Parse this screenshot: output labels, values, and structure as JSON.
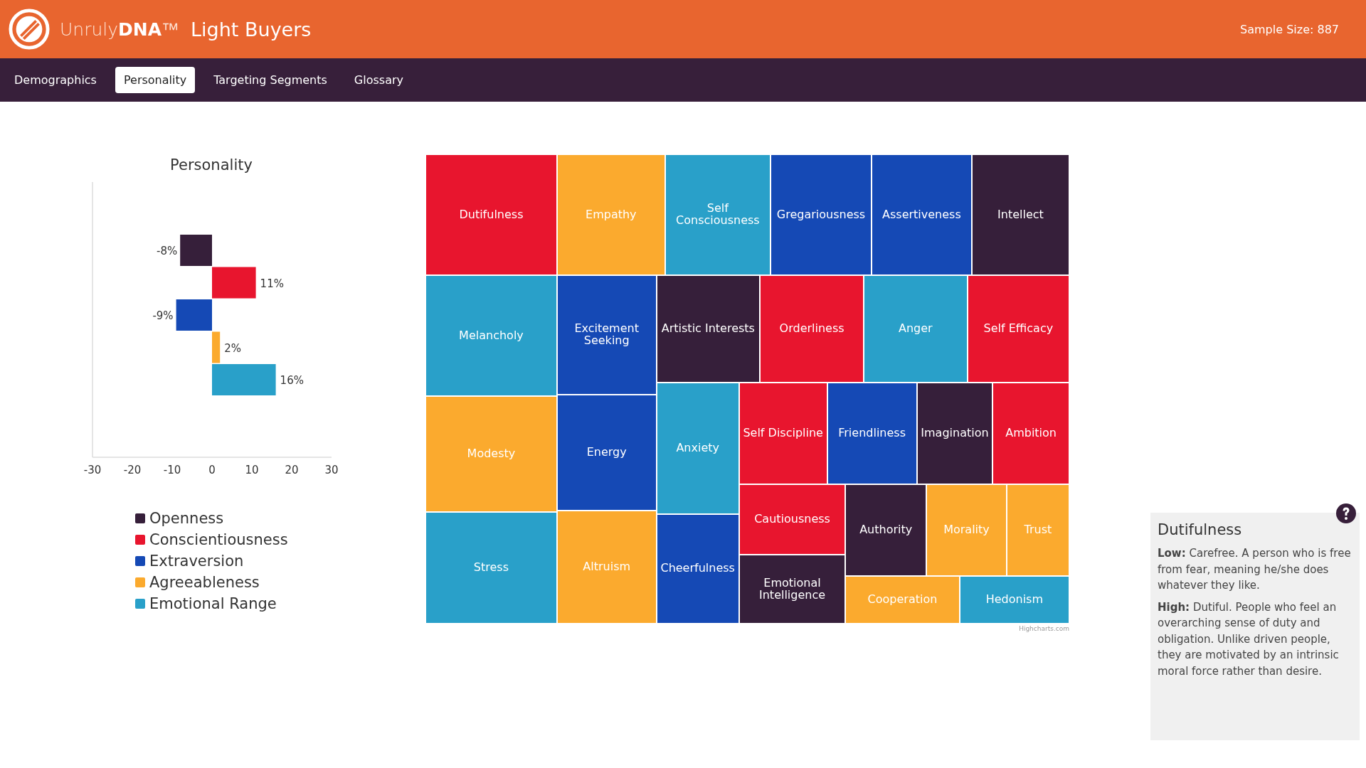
{
  "header": {
    "logo_text": "Unruly**DNA**™",
    "title": "Light Buyers",
    "sample_size": "Sample Size: 887"
  },
  "tabs": [
    {
      "label": "Demographics",
      "selected": false
    },
    {
      "label": "Personality",
      "selected": true
    },
    {
      "label": "Targeting Segments",
      "selected": false
    },
    {
      "label": "Glossary",
      "selected": false
    }
  ],
  "personality_chart": {
    "chart_data": {
      "type": "bar",
      "title": "Personality",
      "orientation": "horizontal",
      "xlim": [
        -30,
        30
      ],
      "xticks": [
        -30,
        -20,
        -10,
        0,
        10,
        20,
        30
      ],
      "series": [
        {
          "name": "Openness",
          "color": "#361f3a",
          "values": [
            -8
          ]
        },
        {
          "name": "Conscientiousness",
          "color": "#e8152e",
          "values": [
            11
          ]
        },
        {
          "name": "Extraversion",
          "color": "#1549b5",
          "values": [
            -9
          ]
        },
        {
          "name": "Agreeableness",
          "color": "#fbaa2e",
          "values": [
            2
          ]
        },
        {
          "name": "Emotional Range",
          "color": "#29a0c9",
          "values": [
            16
          ]
        }
      ],
      "value_labels": [
        "-8%",
        "11%",
        "-9%",
        "2%",
        "16%"
      ]
    }
  },
  "treemap": {
    "tiles": [
      {
        "label": "Dutifulness",
        "color": "#e8152e"
      },
      {
        "label": "Empathy",
        "color": "#fbaa2e"
      },
      {
        "label": "Self Consciousness",
        "color": "#29a0c9"
      },
      {
        "label": "Gregariousness",
        "color": "#1549b5"
      },
      {
        "label": "Assertiveness",
        "color": "#1549b5"
      },
      {
        "label": "Intellect",
        "color": "#361f3a"
      },
      {
        "label": "Melancholy",
        "color": "#29a0c9"
      },
      {
        "label": "Excitement Seeking",
        "color": "#1549b5"
      },
      {
        "label": "Artistic Interests",
        "color": "#361f3a"
      },
      {
        "label": "Orderliness",
        "color": "#e8152e"
      },
      {
        "label": "Anger",
        "color": "#29a0c9"
      },
      {
        "label": "Self Efficacy",
        "color": "#e8152e"
      },
      {
        "label": "Modesty",
        "color": "#fbaa2e"
      },
      {
        "label": "Energy",
        "color": "#1549b5"
      },
      {
        "label": "Anxiety",
        "color": "#29a0c9"
      },
      {
        "label": "Self Discipline",
        "color": "#e8152e"
      },
      {
        "label": "Friendliness",
        "color": "#1549b5"
      },
      {
        "label": "Imagination",
        "color": "#361f3a"
      },
      {
        "label": "Ambition",
        "color": "#e8152e"
      },
      {
        "label": "Stress",
        "color": "#29a0c9"
      },
      {
        "label": "Altruism",
        "color": "#fbaa2e"
      },
      {
        "label": "Cheerfulness",
        "color": "#1549b5"
      },
      {
        "label": "Cautiousness",
        "color": "#e8152e"
      },
      {
        "label": "Emotional Intelligence",
        "color": "#361f3a"
      },
      {
        "label": "Authority",
        "color": "#361f3a"
      },
      {
        "label": "Morality",
        "color": "#fbaa2e"
      },
      {
        "label": "Trust",
        "color": "#fbaa2e"
      },
      {
        "label": "Cooperation",
        "color": "#fbaa2e"
      },
      {
        "label": "Hedonism",
        "color": "#29a0c9"
      }
    ],
    "credit": "Highcharts.com"
  },
  "info_panel": {
    "title": "Dutifulness",
    "paragraphs": [
      "**Low:** Carefree. A person who is free from fear, meaning he/she does whatever they like.",
      "**High:** Dutiful. People who feel an overarching sense of duty and obligation. Unlike driven people, they are motivated by an intrinsic moral force rather than desire."
    ]
  }
}
